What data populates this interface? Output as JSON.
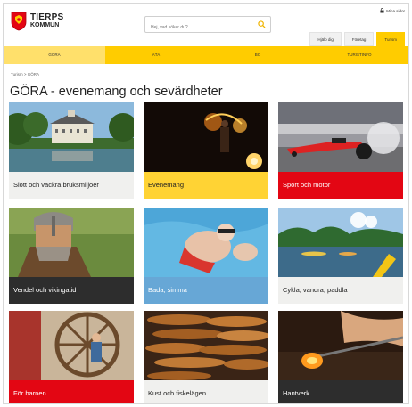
{
  "logo": {
    "main": "TIERPS",
    "sub": "KOMMUN"
  },
  "search": {
    "placeholder": "Hej, vad söker du?"
  },
  "login": {
    "label": "Mina sidor",
    "icon": "lock-icon"
  },
  "tabs": [
    {
      "label": "Hjälp dig"
    },
    {
      "label": "Företag"
    },
    {
      "label": "Turism"
    }
  ],
  "nav": [
    {
      "label": "GÖRA"
    },
    {
      "label": "ÄTA"
    },
    {
      "label": "BO"
    },
    {
      "label": "TURISTINFO"
    }
  ],
  "breadcrumb": "Turism  >  GÖRA",
  "page": {
    "title": "GÖRA - evenemang och sevärdheter"
  },
  "cards": [
    {
      "label": "Slott och vackra bruksmiljöer"
    },
    {
      "label": "Evenemang"
    },
    {
      "label": "Sport och motor"
    },
    {
      "label": "Vendel och vikingatid"
    },
    {
      "label": "Bada, simma"
    },
    {
      "label": "Cykla, vandra, paddla"
    },
    {
      "label": "För barnen"
    },
    {
      "label": "Kust och fiskelägen"
    },
    {
      "label": "Hantverk"
    }
  ],
  "colors": {
    "accent_yellow": "#ffcc00",
    "red": "#e30613",
    "dark": "#2d2d2d",
    "blue": "#67a7d6",
    "grey": "#f0f0ee"
  }
}
